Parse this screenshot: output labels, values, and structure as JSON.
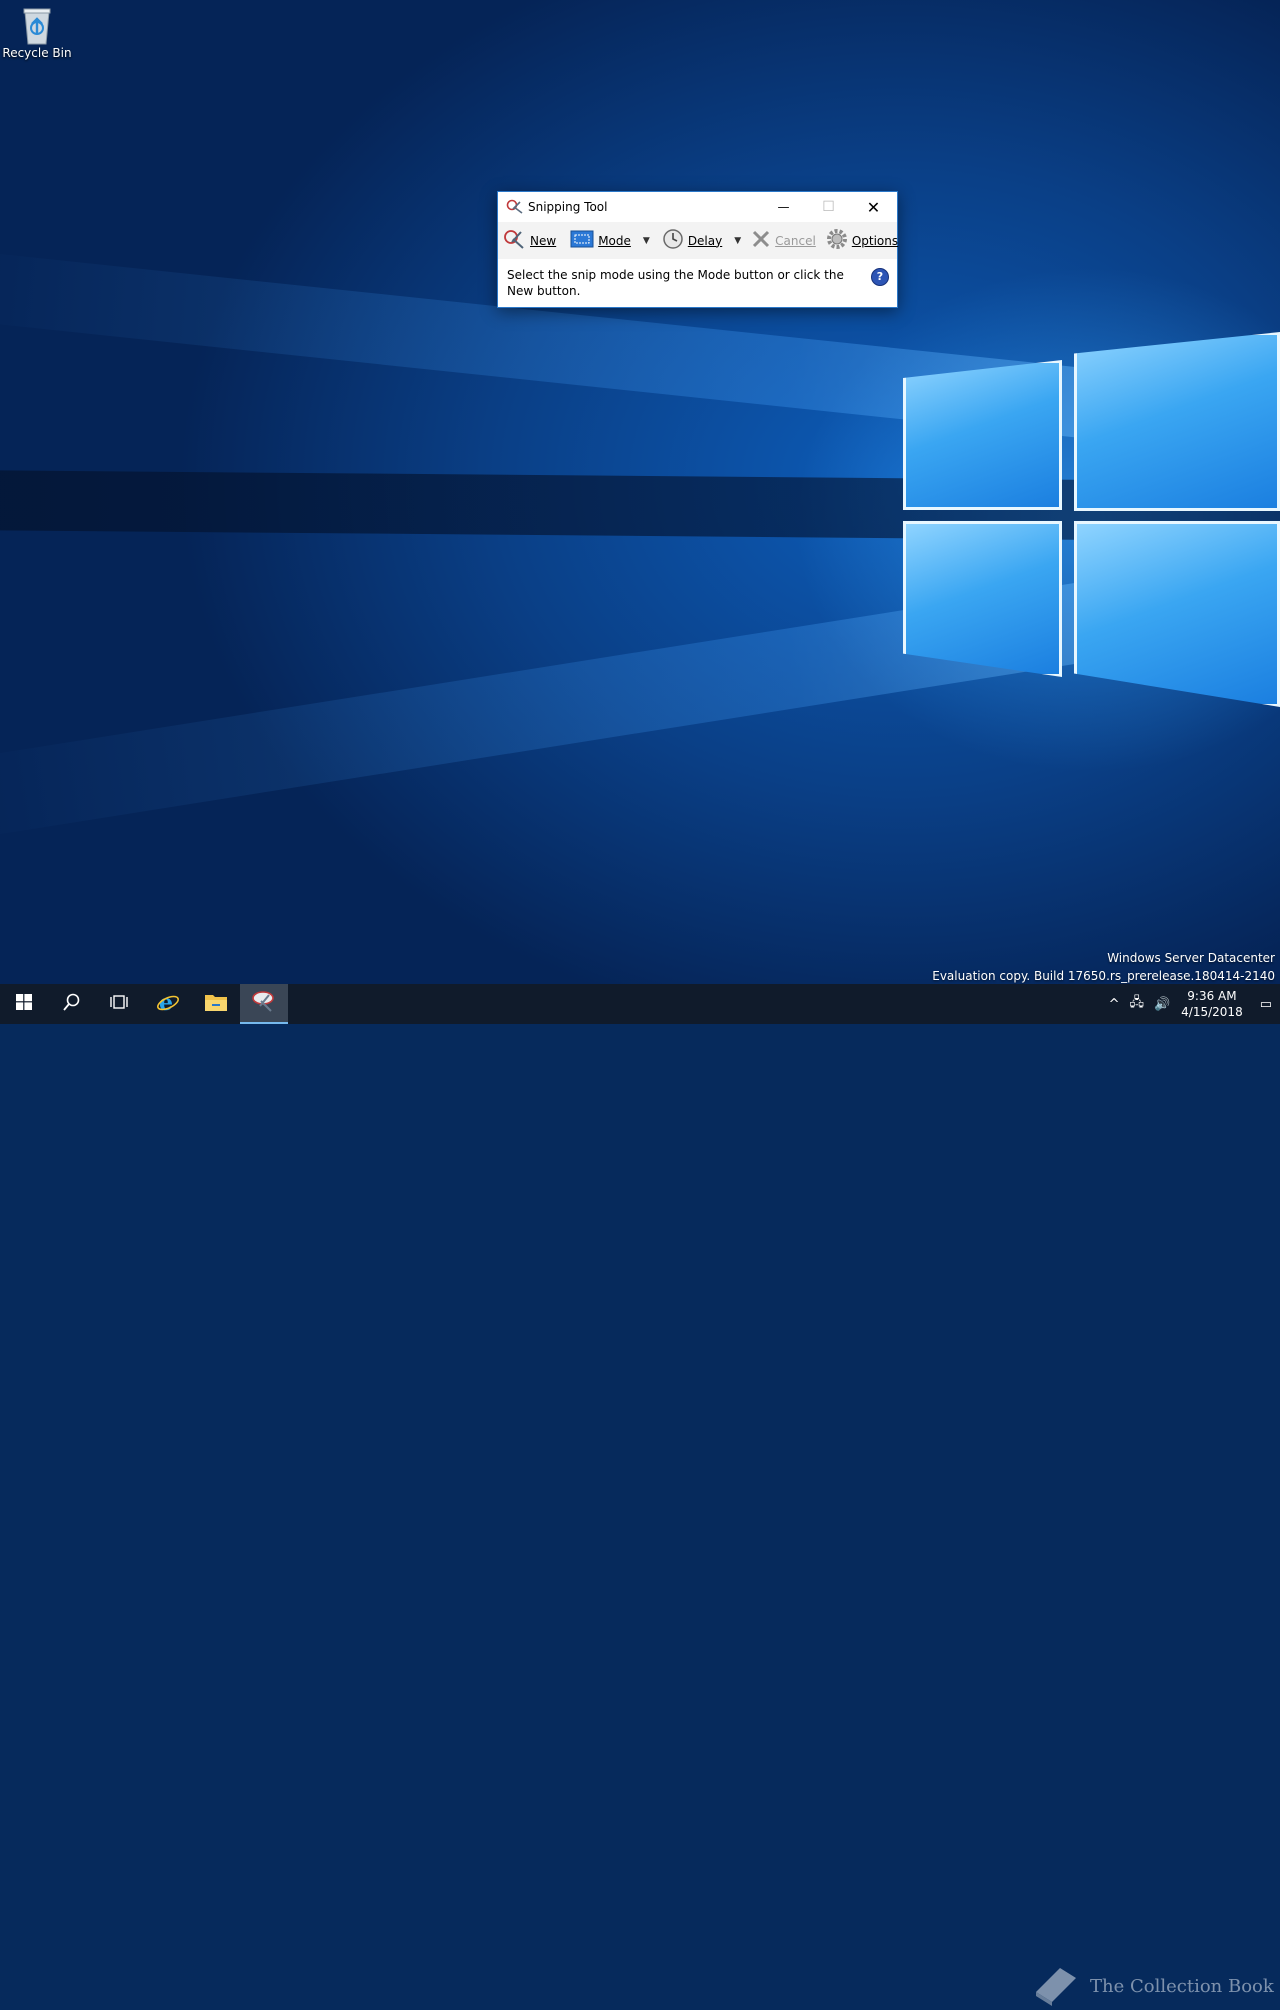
{
  "desktop": {
    "icons": [
      {
        "label": "Recycle Bin",
        "icon": "recycle-bin-icon"
      }
    ],
    "watermark": {
      "line1": "Windows Server Datacenter",
      "line2": "Evaluation copy. Build 17650.rs_prerelease.180414-2140"
    }
  },
  "window": {
    "title": "Snipping Tool",
    "controls": {
      "minimize": "—",
      "maximize": "☐",
      "close": "✕"
    },
    "toolbar": {
      "new_label": "New",
      "mode_label": "Mode",
      "delay_label": "Delay",
      "cancel_label": "Cancel",
      "options_label": "Options"
    },
    "message": "Select the snip mode using the Mode button or click the New button.",
    "help_label": "?"
  },
  "taskbar": {
    "apps": [
      "start-icon",
      "search-icon",
      "task-view-icon",
      "internet-explorer-icon",
      "file-explorer-icon",
      "snipping-tool-icon"
    ],
    "active_app": "snipping-tool-icon",
    "clock": {
      "time": "9:36 AM",
      "date": "4/15/2018"
    },
    "brand_text": "The Collection Book"
  },
  "colors": {
    "accent": "#2b78c9",
    "taskbar": "#101b2b",
    "help": "#2d55b5"
  }
}
